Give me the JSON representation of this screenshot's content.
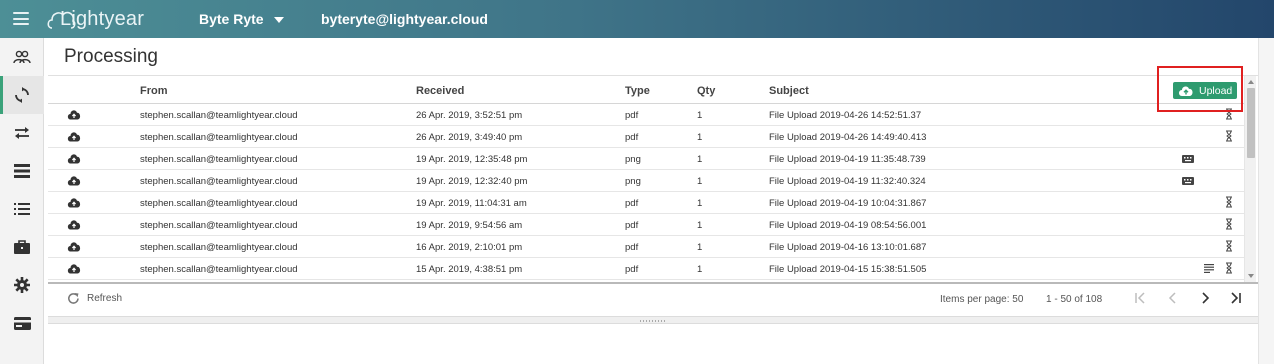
{
  "topbar": {
    "logo_text": "Lightyear",
    "org_name": "Byte Ryte",
    "user_email": "byteryte@lightyear.cloud"
  },
  "sidebar": {
    "items": [
      {
        "name": "users",
        "icon": "users-icon",
        "active": false
      },
      {
        "name": "processing",
        "icon": "sync-icon",
        "active": true
      },
      {
        "name": "transfers",
        "icon": "swap-arrows-icon",
        "active": false
      },
      {
        "name": "list",
        "icon": "list-stack-icon",
        "active": false
      },
      {
        "name": "checklist",
        "icon": "bullet-list-icon",
        "active": false
      },
      {
        "name": "briefcase",
        "icon": "briefcase-icon",
        "active": false
      },
      {
        "name": "settings",
        "icon": "gear-icon",
        "active": false
      },
      {
        "name": "billing",
        "icon": "credit-card-icon",
        "active": false
      }
    ]
  },
  "page": {
    "title": "Processing"
  },
  "upload_button": {
    "label": "Upload",
    "icon": "cloud-upload-icon",
    "color": "#2e9b6f"
  },
  "table": {
    "columns": [
      "From",
      "Received",
      "Type",
      "Qty",
      "Subject"
    ],
    "rows": [
      {
        "from": "stephen.scallan@teamlightyear.cloud",
        "received": "26 Apr. 2019, 3:52:51 pm",
        "type": "pdf",
        "qty": "1",
        "subject": "File Upload 2019-04-26 14:52:51.37",
        "status_icon": "hourglass-icon"
      },
      {
        "from": "stephen.scallan@teamlightyear.cloud",
        "received": "26 Apr. 2019, 3:49:40 pm",
        "type": "pdf",
        "qty": "1",
        "subject": "File Upload 2019-04-26 14:49:40.413",
        "status_icon": "hourglass-icon"
      },
      {
        "from": "stephen.scallan@teamlightyear.cloud",
        "received": "19 Apr. 2019, 12:35:48 pm",
        "type": "png",
        "qty": "1",
        "subject": "File Upload 2019-04-19 11:35:48.739",
        "status_icon": "keyboard-icon"
      },
      {
        "from": "stephen.scallan@teamlightyear.cloud",
        "received": "19 Apr. 2019, 12:32:40 pm",
        "type": "png",
        "qty": "1",
        "subject": "File Upload 2019-04-19 11:32:40.324",
        "status_icon": "keyboard-icon"
      },
      {
        "from": "stephen.scallan@teamlightyear.cloud",
        "received": "19 Apr. 2019, 11:04:31 am",
        "type": "pdf",
        "qty": "1",
        "subject": "File Upload 2019-04-19 10:04:31.867",
        "status_icon": "hourglass-icon"
      },
      {
        "from": "stephen.scallan@teamlightyear.cloud",
        "received": "19 Apr. 2019, 9:54:56 am",
        "type": "pdf",
        "qty": "1",
        "subject": "File Upload 2019-04-19 08:54:56.001",
        "status_icon": "hourglass-icon"
      },
      {
        "from": "stephen.scallan@teamlightyear.cloud",
        "received": "16 Apr. 2019, 2:10:01 pm",
        "type": "pdf",
        "qty": "1",
        "subject": "File Upload 2019-04-16 13:10:01.687",
        "status_icon": "hourglass-icon"
      },
      {
        "from": "stephen.scallan@teamlightyear.cloud",
        "received": "15 Apr. 2019, 4:38:51 pm",
        "type": "pdf",
        "qty": "1",
        "subject": "File Upload 2019-04-15 15:38:51.505",
        "status_icon": "lines-hourglass-icon"
      }
    ]
  },
  "footer": {
    "refresh_label": "Refresh",
    "items_per_page": "Items per page: 50",
    "range_label": "1 - 50 of 108"
  }
}
